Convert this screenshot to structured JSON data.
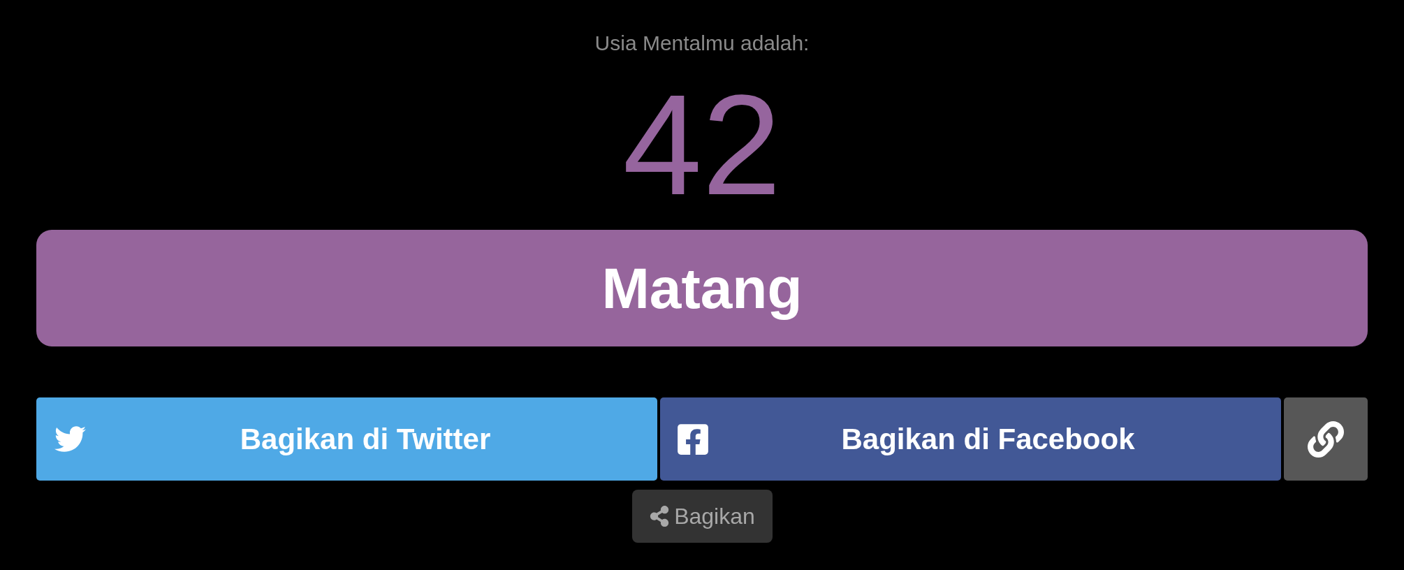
{
  "result": {
    "label": "Usia Mentalmu adalah:",
    "age": "42",
    "category": "Matang"
  },
  "share_buttons": [
    {
      "kind": "twitter",
      "label": "Bagikan di Twitter"
    },
    {
      "kind": "facebook",
      "label": "Bagikan di Facebook"
    },
    {
      "kind": "link"
    }
  ],
  "share_toggle": {
    "label": "Bagikan"
  }
}
